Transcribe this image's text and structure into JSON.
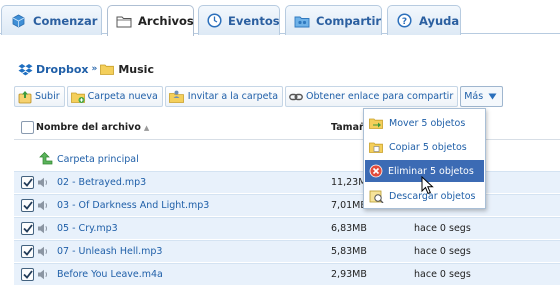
{
  "tabs": [
    {
      "label": "Comenzar",
      "icon": "dropbox-box-icon",
      "active": false
    },
    {
      "label": "Archivos",
      "icon": "folder-icon",
      "active": true
    },
    {
      "label": "Eventos",
      "icon": "clock-icon",
      "active": false
    },
    {
      "label": "Compartir",
      "icon": "share-folder-icon",
      "active": false
    },
    {
      "label": "Ayuda",
      "icon": "help-icon",
      "active": false
    }
  ],
  "breadcrumb": {
    "root": "Dropbox",
    "separator": "»",
    "current": "Music"
  },
  "toolbar": {
    "upload": "Subir",
    "new_folder": "Carpeta nueva",
    "invite": "Invitar a la carpeta",
    "share_link": "Obtener enlace para compartir",
    "more": "Más"
  },
  "table": {
    "col_name": "Nombre del archivo",
    "col_size": "Tamañ",
    "parent_link": "Carpeta principal",
    "rows": [
      {
        "name": "02 - Betrayed.mp3",
        "size": "11,23M",
        "modified": "",
        "checked": true
      },
      {
        "name": "03 - Of Darkness And Light.mp3",
        "size": "7,01MB",
        "modified": "",
        "checked": true
      },
      {
        "name": "05 - Cry.mp3",
        "size": "6,83MB",
        "modified": "hace 0 segs",
        "checked": true
      },
      {
        "name": "07 - Unleash Hell.mp3",
        "size": "5,83MB",
        "modified": "hace 0 segs",
        "checked": true
      },
      {
        "name": "Before You Leave.m4a",
        "size": "2,93MB",
        "modified": "hace 0 segs",
        "checked": true
      }
    ]
  },
  "menu": {
    "items": [
      {
        "label": "Mover 5 objetos",
        "icon": "move-icon"
      },
      {
        "label": "Copiar 5 objetos",
        "icon": "copy-icon"
      },
      {
        "label": "Eliminar 5 objetos",
        "icon": "delete-icon",
        "highlighted": true
      },
      {
        "label": "Descargar objetos",
        "icon": "download-icon"
      }
    ]
  },
  "colors": {
    "link": "#1f5fa8",
    "tab_border": "#b7cbe0",
    "selected_row": "#e8f1fb",
    "menu_highlight": "#3c6bb4"
  }
}
